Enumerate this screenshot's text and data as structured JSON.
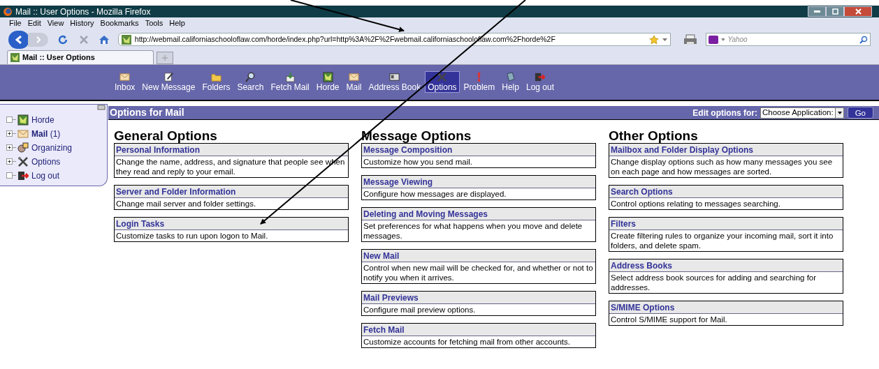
{
  "window": {
    "title": "Mail :: User Options - Mozilla Firefox"
  },
  "menu": [
    "File",
    "Edit",
    "View",
    "History",
    "Bookmarks",
    "Tools",
    "Help"
  ],
  "address_bar": {
    "value": "http://webmail.californiaschooloflaw.com/horde/index.php?url=http%3A%2F%2Fwebmail.californiaschooloflaw.com%2Fhorde%2F"
  },
  "search": {
    "placeholder": "Yahoo"
  },
  "tabs": [
    {
      "label": "Mail :: User Options",
      "selected": true
    }
  ],
  "toolbar": [
    {
      "label": "Inbox",
      "selected": false
    },
    {
      "label": "New Message",
      "selected": false
    },
    {
      "label": "Folders",
      "selected": false
    },
    {
      "label": "Search",
      "selected": false
    },
    {
      "label": "Fetch Mail",
      "selected": false
    },
    {
      "label": "Horde",
      "selected": false
    },
    {
      "label": "Mail",
      "selected": false
    },
    {
      "label": "Address Book",
      "selected": false
    },
    {
      "label": "Options",
      "selected": true
    },
    {
      "label": "Problem",
      "selected": false
    },
    {
      "label": "Help",
      "selected": false
    },
    {
      "label": "Log out",
      "selected": false
    }
  ],
  "sidebar": {
    "items": [
      {
        "label": "Horde",
        "kind": "leaf"
      },
      {
        "label": "**Mail** (1)",
        "kind": "expandable"
      },
      {
        "label": "Organizing",
        "kind": "expandable"
      },
      {
        "label": "Options",
        "kind": "expandable"
      },
      {
        "label": "Log out",
        "kind": "leaf"
      }
    ]
  },
  "header": {
    "title": "Options for Mail",
    "edit_label": "Edit options for:",
    "select": "Choose Application:",
    "button": "Go"
  },
  "columns": [
    {
      "title": "General Options",
      "groups": [
        {
          "title": "Personal Information",
          "description": "Change the name, address, and signature that people see when they read and reply to your email."
        },
        {
          "title": "Server and Folder Information",
          "description": "Change mail server and folder settings."
        },
        {
          "title": "Login Tasks",
          "description": "Customize tasks to run upon logon to Mail."
        }
      ]
    },
    {
      "title": "Message Options",
      "groups": [
        {
          "title": "Message Composition",
          "description": "Customize how you send mail."
        },
        {
          "title": "Message Viewing",
          "description": "Configure how messages are displayed."
        },
        {
          "title": "Deleting and Moving Messages",
          "description": "Set preferences for what happens when you move and delete messages."
        },
        {
          "title": "New Mail",
          "description": "Control when new mail will be checked for, and whether or not to notify you when it arrives."
        },
        {
          "title": "Mail Previews",
          "description": "Configure mail preview options."
        },
        {
          "title": "Fetch Mail",
          "description": "Customize accounts for fetching mail from other accounts."
        }
      ]
    },
    {
      "title": "Other Options",
      "groups": [
        {
          "title": "Mailbox and Folder Display Options",
          "description": "Change display options such as how many messages you see on each page and how messages are sorted."
        },
        {
          "title": "Search Options",
          "description": "Control options relating to messages searching."
        },
        {
          "title": "Filters",
          "description": "Create filtering rules to organize your incoming mail, sort it into folders, and delete spam."
        },
        {
          "title": "Address Books",
          "description": "Select address book sources for adding and searching for addresses."
        },
        {
          "title": "S/MIME Options",
          "description": "Control S/MIME support for Mail."
        }
      ]
    }
  ]
}
